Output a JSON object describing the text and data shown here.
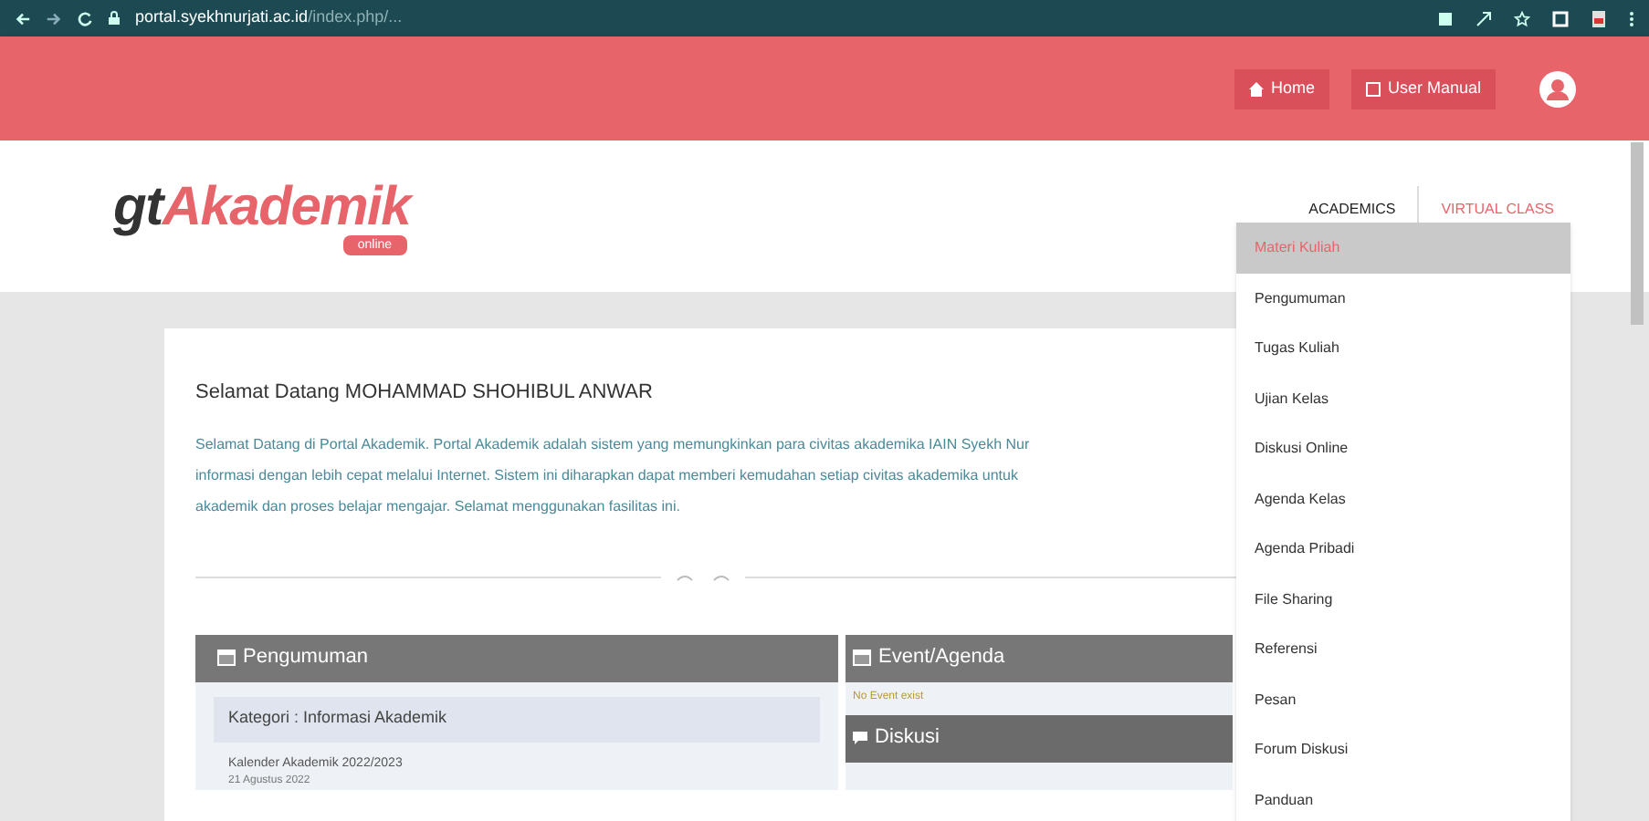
{
  "browser": {
    "url_domain": "portal.syekhnurjati.ac.id",
    "url_path": "/index.php/..."
  },
  "topbar": {
    "buttons": [
      {
        "label": "Home",
        "kind": "home"
      },
      {
        "label": "User Manual",
        "kind": "manual"
      }
    ]
  },
  "logo": {
    "prefix": "gt",
    "name": "Akademik",
    "badge": "online"
  },
  "nav": [
    {
      "label": "ACADEMICS",
      "selected": false
    },
    {
      "label": "VIRTUAL CLASS",
      "selected": true
    }
  ],
  "menu": [
    {
      "label": "Materi Kuliah",
      "selected": true
    },
    {
      "label": "Pengumuman",
      "selected": false
    },
    {
      "label": "Tugas Kuliah",
      "selected": false
    },
    {
      "label": "Ujian Kelas",
      "selected": false
    },
    {
      "label": "Diskusi Online",
      "selected": false
    },
    {
      "label": "Agenda Kelas",
      "selected": false
    },
    {
      "label": "Agenda Pribadi",
      "selected": false
    },
    {
      "label": "File Sharing",
      "selected": false
    },
    {
      "label": "Referensi",
      "selected": false
    },
    {
      "label": "Pesan",
      "selected": false
    },
    {
      "label": "Forum Diskusi",
      "selected": false
    },
    {
      "label": "Panduan",
      "selected": false
    }
  ],
  "welcome": {
    "title": "Selamat Datang MOHAMMAD SHOHIBUL ANWAR",
    "lines": [
      "Selamat Datang di Portal Akademik. Portal Akademik adalah sistem yang memungkinkan para civitas akademika IAIN Syekh Nur",
      "informasi dengan lebih cepat melalui Internet. Sistem ini diharapkan dapat memberi kemudahan setiap civitas akademika untuk",
      "akademik dan proses belajar mengajar. Selamat menggunakan fasilitas ini."
    ]
  },
  "announcements": {
    "title": "Pengumuman",
    "category": "Kategori : Informasi Akademik",
    "item": "Kalender Akademik 2022/2023",
    "date": "21 Agustus 2022"
  },
  "events": {
    "title": "Event/Agenda",
    "empty": "No Event exist"
  },
  "discussion": {
    "title": "Diskusi"
  }
}
